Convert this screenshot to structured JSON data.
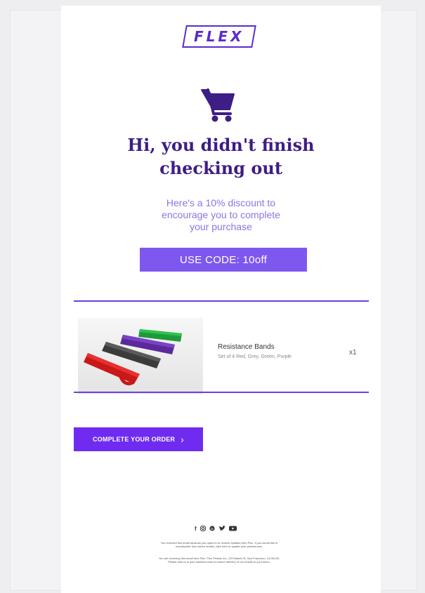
{
  "brand": {
    "logo_text": "FLEX",
    "primary_color": "#6f2cf0",
    "accent_color": "#7e58ee",
    "heading_color": "#3e1d85"
  },
  "hero": {
    "icon": "shopping-cart-icon",
    "headline_line1": "Hi, you didn't finish",
    "headline_line2": "checking out",
    "subtext_line1": "Here's a 10% discount to",
    "subtext_line2": "encourage you to complete",
    "subtext_line3": "your purchase",
    "code_label": "USE CODE: 10off"
  },
  "cart": {
    "items": [
      {
        "name": "Resistance Bands",
        "description": "Set of 4 Red, Grey, Green, Purple",
        "quantity": "x1",
        "image": "resistance-bands-image"
      }
    ]
  },
  "cta": {
    "label": "COMPLETE YOUR ORDER",
    "chevron": "chevron-right-icon"
  },
  "footer": {
    "social_icons": [
      "facebook-icon",
      "instagram-icon",
      "pinterest-icon",
      "twitter-icon",
      "youtube-icon"
    ],
    "line1": "You received this email because you opted in to receive updates from Flex. If you would like to",
    "line2": "unsubscribe from future emails, click here to update your preferences.",
    "line3": "You are receiving this email from Flex. Flex Fitness Inc, 123 Market St, San Francisco, CA 94105.",
    "line4": "Please add us to your address book to ensure delivery of our emails to your inbox."
  }
}
